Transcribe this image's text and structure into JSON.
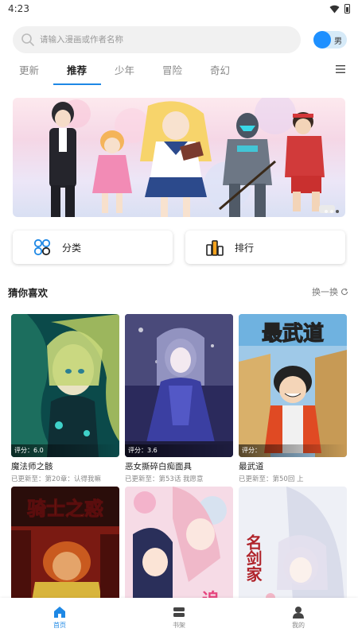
{
  "status_bar": {
    "time": "4:23"
  },
  "search": {
    "placeholder": "请输入漫画或作者名称"
  },
  "gender_toggle": {
    "label": "男"
  },
  "tabs": [
    {
      "label": "更新",
      "active": false
    },
    {
      "label": "推荐",
      "active": true
    },
    {
      "label": "少年",
      "active": false
    },
    {
      "label": "冒险",
      "active": false
    },
    {
      "label": "奇幻",
      "active": false
    }
  ],
  "quick_buttons": [
    {
      "label": "分类",
      "icon": "category-icon"
    },
    {
      "label": "排行",
      "icon": "ranking-icon"
    }
  ],
  "section": {
    "title": "猜你喜欢",
    "more_label": "换一换"
  },
  "comics": [
    {
      "title": "魔法师之骸",
      "update": "已更新至：第20章：认得我嘛",
      "score": "评分：6.0"
    },
    {
      "title": "恶女撕碎白痴面具",
      "update": "已更新至：第53话 我愿意",
      "score": "评分：3.6"
    },
    {
      "title": "最武道",
      "update": "已更新至：第50回 上",
      "score": "评分："
    },
    {
      "title": "",
      "update": "",
      "score": ""
    },
    {
      "title": "",
      "update": "",
      "score": ""
    },
    {
      "title": "",
      "update": "",
      "score": ""
    }
  ],
  "cover_texts": {
    "c3": "最武道",
    "c4": "骑士之惑",
    "c5": "追",
    "c6": "名剑家"
  },
  "bottom_nav": [
    {
      "label": "首页",
      "active": true
    },
    {
      "label": "书架",
      "active": false
    },
    {
      "label": "我的",
      "active": false
    }
  ],
  "colors": {
    "accent": "#1e88e5",
    "toggle": "#1e90ff"
  }
}
